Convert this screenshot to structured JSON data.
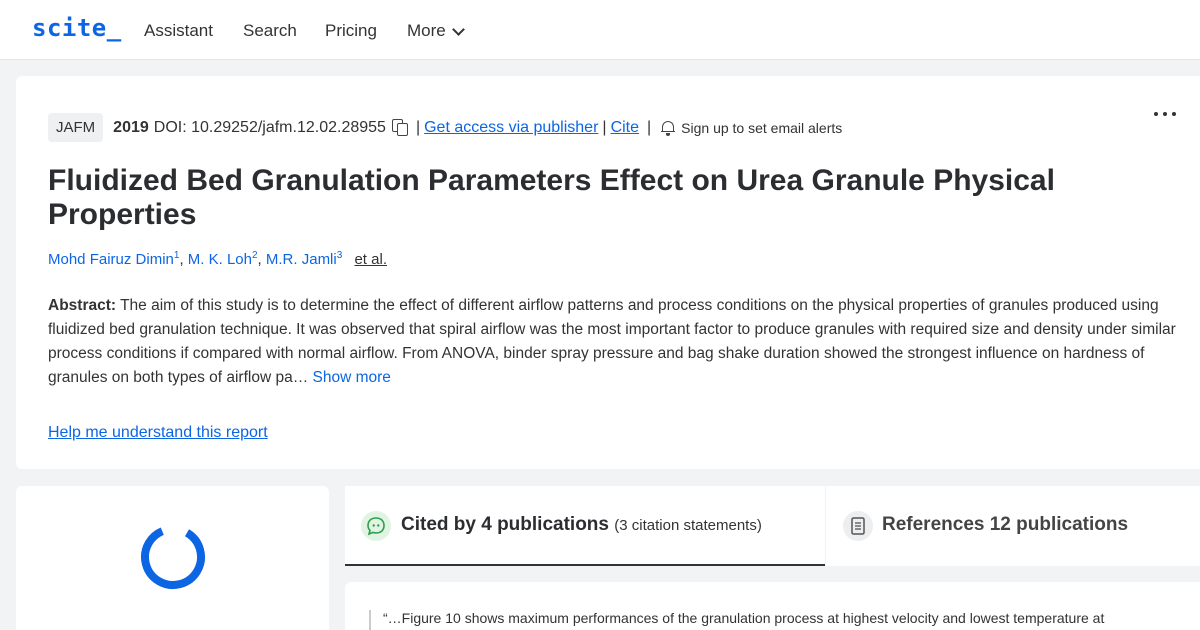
{
  "header": {
    "logo": "scite_",
    "nav": [
      "Assistant",
      "Search",
      "Pricing",
      "More"
    ]
  },
  "paper": {
    "journal": "JAFM",
    "year": "2019",
    "doi": "DOI: 10.29252/jafm.12.02.28955",
    "publisher_link": "Get access via publisher",
    "cite_link": "Cite",
    "alerts": "Sign up to set email alerts",
    "title": "Fluidized Bed Granulation Parameters Effect on Urea Granule Physical Properties",
    "authors": [
      {
        "name": "Mohd Fairuz Dimin",
        "sup": "1"
      },
      {
        "name": "M. K. Loh",
        "sup": "2"
      },
      {
        "name": "M.R. Jamli",
        "sup": "3"
      }
    ],
    "et_al": "et al.",
    "abstract_label": "Abstract:",
    "abstract_text": "The aim of this study is to determine the effect of different airflow patterns and process conditions on the physical properties of granules produced using fluidized bed granulation technique. It was observed that spiral airflow was the most important factor to produce granules with required size and density under similar process conditions if compared with normal airflow. From ANOVA, binder spray pressure and bag shake duration showed the strongest influence on hardness of granules on both types of airflow pa…",
    "show_more": "Show more",
    "help_link": "Help me understand this report"
  },
  "tabs": {
    "cited_by": "Cited by 4 publications",
    "cited_sub": "(3 citation statements)",
    "references": "References 12 publications"
  },
  "quote": "“…Figure 10 shows maximum performances of the granulation process at highest velocity and lowest temperature at",
  "colors": {
    "accent": "#0c66e4",
    "cited_icon_bg": "#e1f4e4",
    "cited_icon": "#2e9e4a"
  }
}
